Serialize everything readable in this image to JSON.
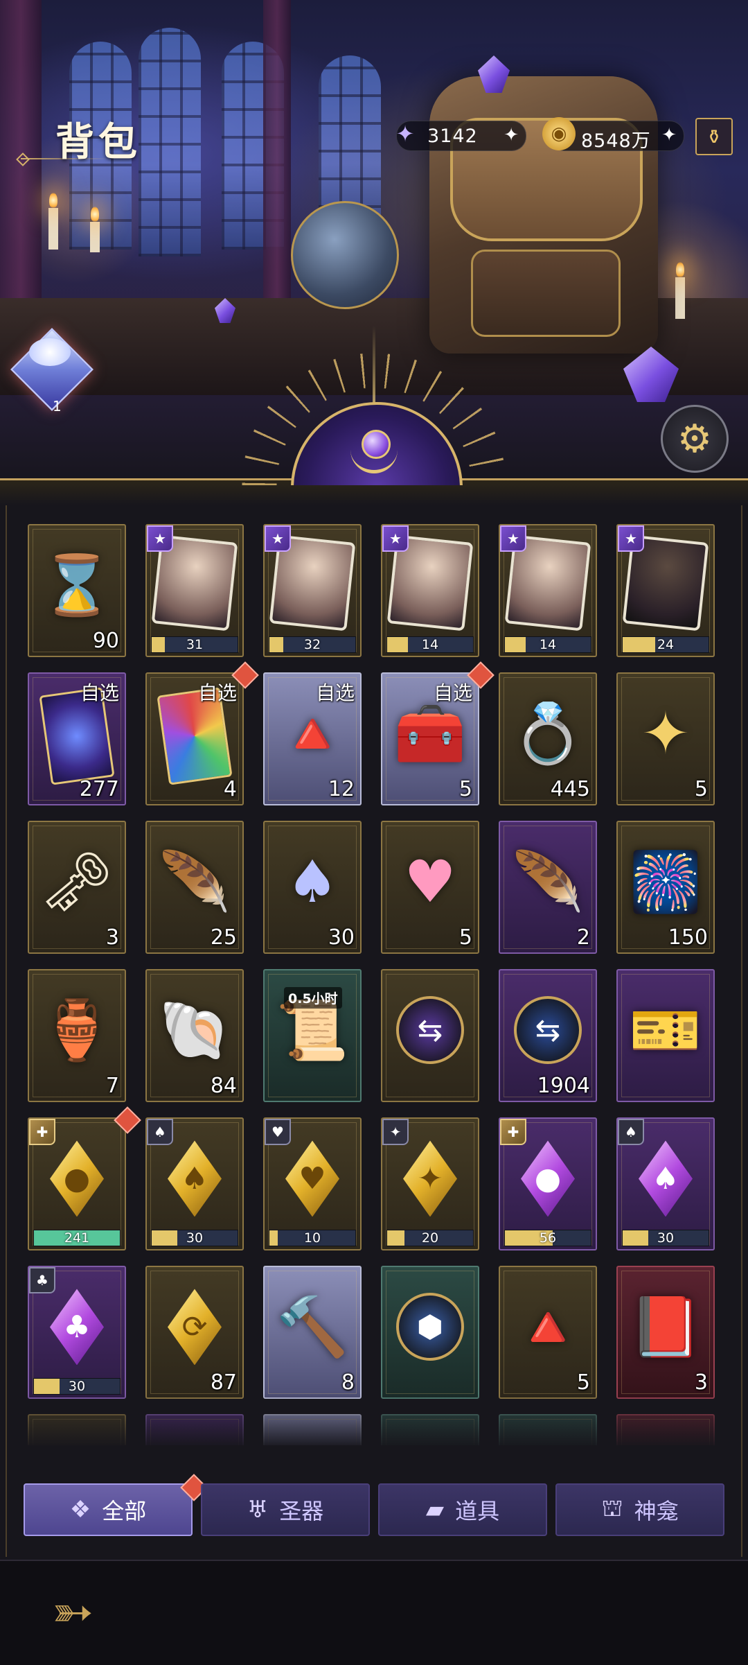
{
  "header": {
    "title": "背包",
    "currencies": [
      {
        "icon": "star-crystal-icon",
        "value": "3142",
        "plus": "✦"
      },
      {
        "icon": "gold-coin-icon",
        "value": "8548万",
        "plus": "✦"
      }
    ],
    "gift_count": "1"
  },
  "items": [
    {
      "art": "⌛",
      "cls": "gold",
      "qty": "90"
    },
    {
      "puzzle": true,
      "cls": "gold",
      "badge": "★",
      "bar": "31",
      "fill": 0.15
    },
    {
      "puzzle": true,
      "cls": "gold",
      "badge": "★",
      "bar": "32",
      "fill": 0.16
    },
    {
      "puzzle": true,
      "cls": "gold",
      "badge": "★",
      "bar": "14",
      "fill": 0.24
    },
    {
      "puzzle": true,
      "cls": "gold",
      "badge": "★",
      "bar": "14",
      "fill": 0.24
    },
    {
      "puzzle": true,
      "cls": "gold",
      "badge": "★",
      "bar": "24",
      "fill": 0.38,
      "dark": true
    },
    {
      "card": "purple",
      "cls": "purple",
      "tag": "自选",
      "qty": "277"
    },
    {
      "card": "rainbow",
      "cls": "gold",
      "tag": "自选",
      "qty": "4",
      "dot": true
    },
    {
      "art": "🔺",
      "cls": "silver",
      "tag": "自选",
      "qty": "12"
    },
    {
      "art": "🧰",
      "cls": "silver",
      "tag": "自选",
      "qty": "5",
      "dot": true
    },
    {
      "art": "💍",
      "cls": "gold",
      "qty": "445"
    },
    {
      "art": "✦",
      "cls": "gold",
      "qty": "5",
      "color": "#f3d06a"
    },
    {
      "art": "🗝",
      "cls": "gold",
      "qty": "3"
    },
    {
      "art": "🪶",
      "cls": "gold",
      "qty": "25"
    },
    {
      "art": "♠",
      "cls": "gold",
      "qty": "30",
      "color": "#b9c2ff"
    },
    {
      "art": "♥",
      "cls": "gold",
      "qty": "5",
      "color": "#ff9ac0"
    },
    {
      "art": "🪶",
      "cls": "purple",
      "qty": "2"
    },
    {
      "art": "🎆",
      "cls": "gold",
      "qty": "150"
    },
    {
      "art": "🏺",
      "cls": "gold",
      "qty": "7"
    },
    {
      "art": "🐚",
      "cls": "gold",
      "qty": "84"
    },
    {
      "art": "📜",
      "cls": "teal",
      "timer": "0.5小时"
    },
    {
      "pill": "⇆",
      "cls": "gold",
      "pillcolor": "#5a3aa0"
    },
    {
      "pill": "⇆",
      "cls": "purple",
      "qty": "1904",
      "pillcolor": "#2b4c9a"
    },
    {
      "art": "🎫",
      "cls": "purple"
    },
    {
      "diamond": "gold",
      "sym": "●",
      "cls": "gold",
      "badge": "✚",
      "badgecls": "gold",
      "bar": "241",
      "fill": 1.0,
      "green": true,
      "dot": true
    },
    {
      "diamond": "gold",
      "sym": "♠",
      "cls": "gold",
      "badge": "♠",
      "badgecls": "dark",
      "bar": "30",
      "fill": 0.3
    },
    {
      "diamond": "gold",
      "sym": "♥",
      "cls": "gold",
      "badge": "♥",
      "badgecls": "dark",
      "bar": "10",
      "fill": 0.1
    },
    {
      "diamond": "gold",
      "sym": "✦",
      "cls": "gold",
      "badge": "✦",
      "badgecls": "dark",
      "bar": "20",
      "fill": 0.2
    },
    {
      "diamond": "purple",
      "sym": "●",
      "cls": "purple",
      "badge": "✚",
      "badgecls": "gold",
      "bar": "56",
      "fill": 0.56
    },
    {
      "diamond": "purple",
      "sym": "♠",
      "cls": "purple",
      "badge": "♠",
      "badgecls": "dark",
      "bar": "30",
      "fill": 0.3
    },
    {
      "diamond": "purple",
      "sym": "♣",
      "cls": "purple",
      "badge": "♣",
      "badgecls": "dark",
      "bar": "30",
      "fill": 0.3
    },
    {
      "diamond": "gold",
      "sym": "⟳",
      "cls": "gold",
      "qty": "87"
    },
    {
      "art": "🔨",
      "cls": "silver",
      "qty": "8"
    },
    {
      "pill": "⬢",
      "cls": "teal",
      "pillcolor": "#3a5fa8"
    },
    {
      "art": "🔺",
      "cls": "gold",
      "qty": "5"
    },
    {
      "art": "📕",
      "cls": "red",
      "qty": "3"
    },
    {
      "art": "",
      "cls": "gold"
    },
    {
      "art": "",
      "cls": "purple"
    },
    {
      "art": "",
      "cls": "silver"
    },
    {
      "art": "",
      "cls": "teal"
    },
    {
      "art": "",
      "cls": "teal"
    },
    {
      "art": "",
      "cls": "red"
    }
  ],
  "tabs": [
    {
      "label": "全部",
      "icon": "grid-icon",
      "glyph": "❖",
      "active": true
    },
    {
      "label": "圣器",
      "icon": "chalice-icon",
      "glyph": "♅",
      "active": false
    },
    {
      "label": "道具",
      "icon": "gold-bars-icon",
      "glyph": "▰",
      "active": false
    },
    {
      "label": "神龛",
      "icon": "shrine-icon",
      "glyph": "⛫",
      "active": false
    }
  ],
  "colors": {
    "accent": "#d7b46a",
    "tab_active": "#6c62a8",
    "red_dot": "#e0543f"
  }
}
